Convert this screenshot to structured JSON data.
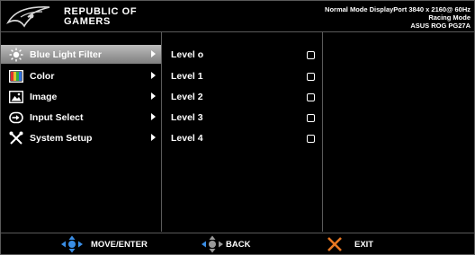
{
  "header": {
    "brand_line1": "REPUBLIC OF",
    "brand_line2": "GAMERS",
    "info_line1": "Normal Mode DisplayPort 3840 x 2160@ 60Hz",
    "info_line2": "Racing Mode",
    "info_line3": "ASUS ROG PG27A"
  },
  "menu": {
    "items": [
      {
        "label": "Blue Light Filter",
        "icon": "sun-icon",
        "selected": true
      },
      {
        "label": "Color",
        "icon": "palette-icon",
        "selected": false
      },
      {
        "label": "Image",
        "icon": "image-icon",
        "selected": false
      },
      {
        "label": "Input Select",
        "icon": "input-icon",
        "selected": false
      },
      {
        "label": "System Setup",
        "icon": "wrench-icon",
        "selected": false
      }
    ]
  },
  "levels": {
    "items": [
      {
        "label": "Level o"
      },
      {
        "label": "Level 1"
      },
      {
        "label": "Level 2"
      },
      {
        "label": "Level 3"
      },
      {
        "label": "Level 4"
      }
    ]
  },
  "footer": {
    "move_enter": "MOVE/ENTER",
    "back": "BACK",
    "exit": "EXIT"
  },
  "colors": {
    "accent_blue": "#3a8ee6",
    "selection_top": "#bdbdbd",
    "selection_bottom": "#7f7f7f",
    "exit_orange": "#e87722"
  }
}
